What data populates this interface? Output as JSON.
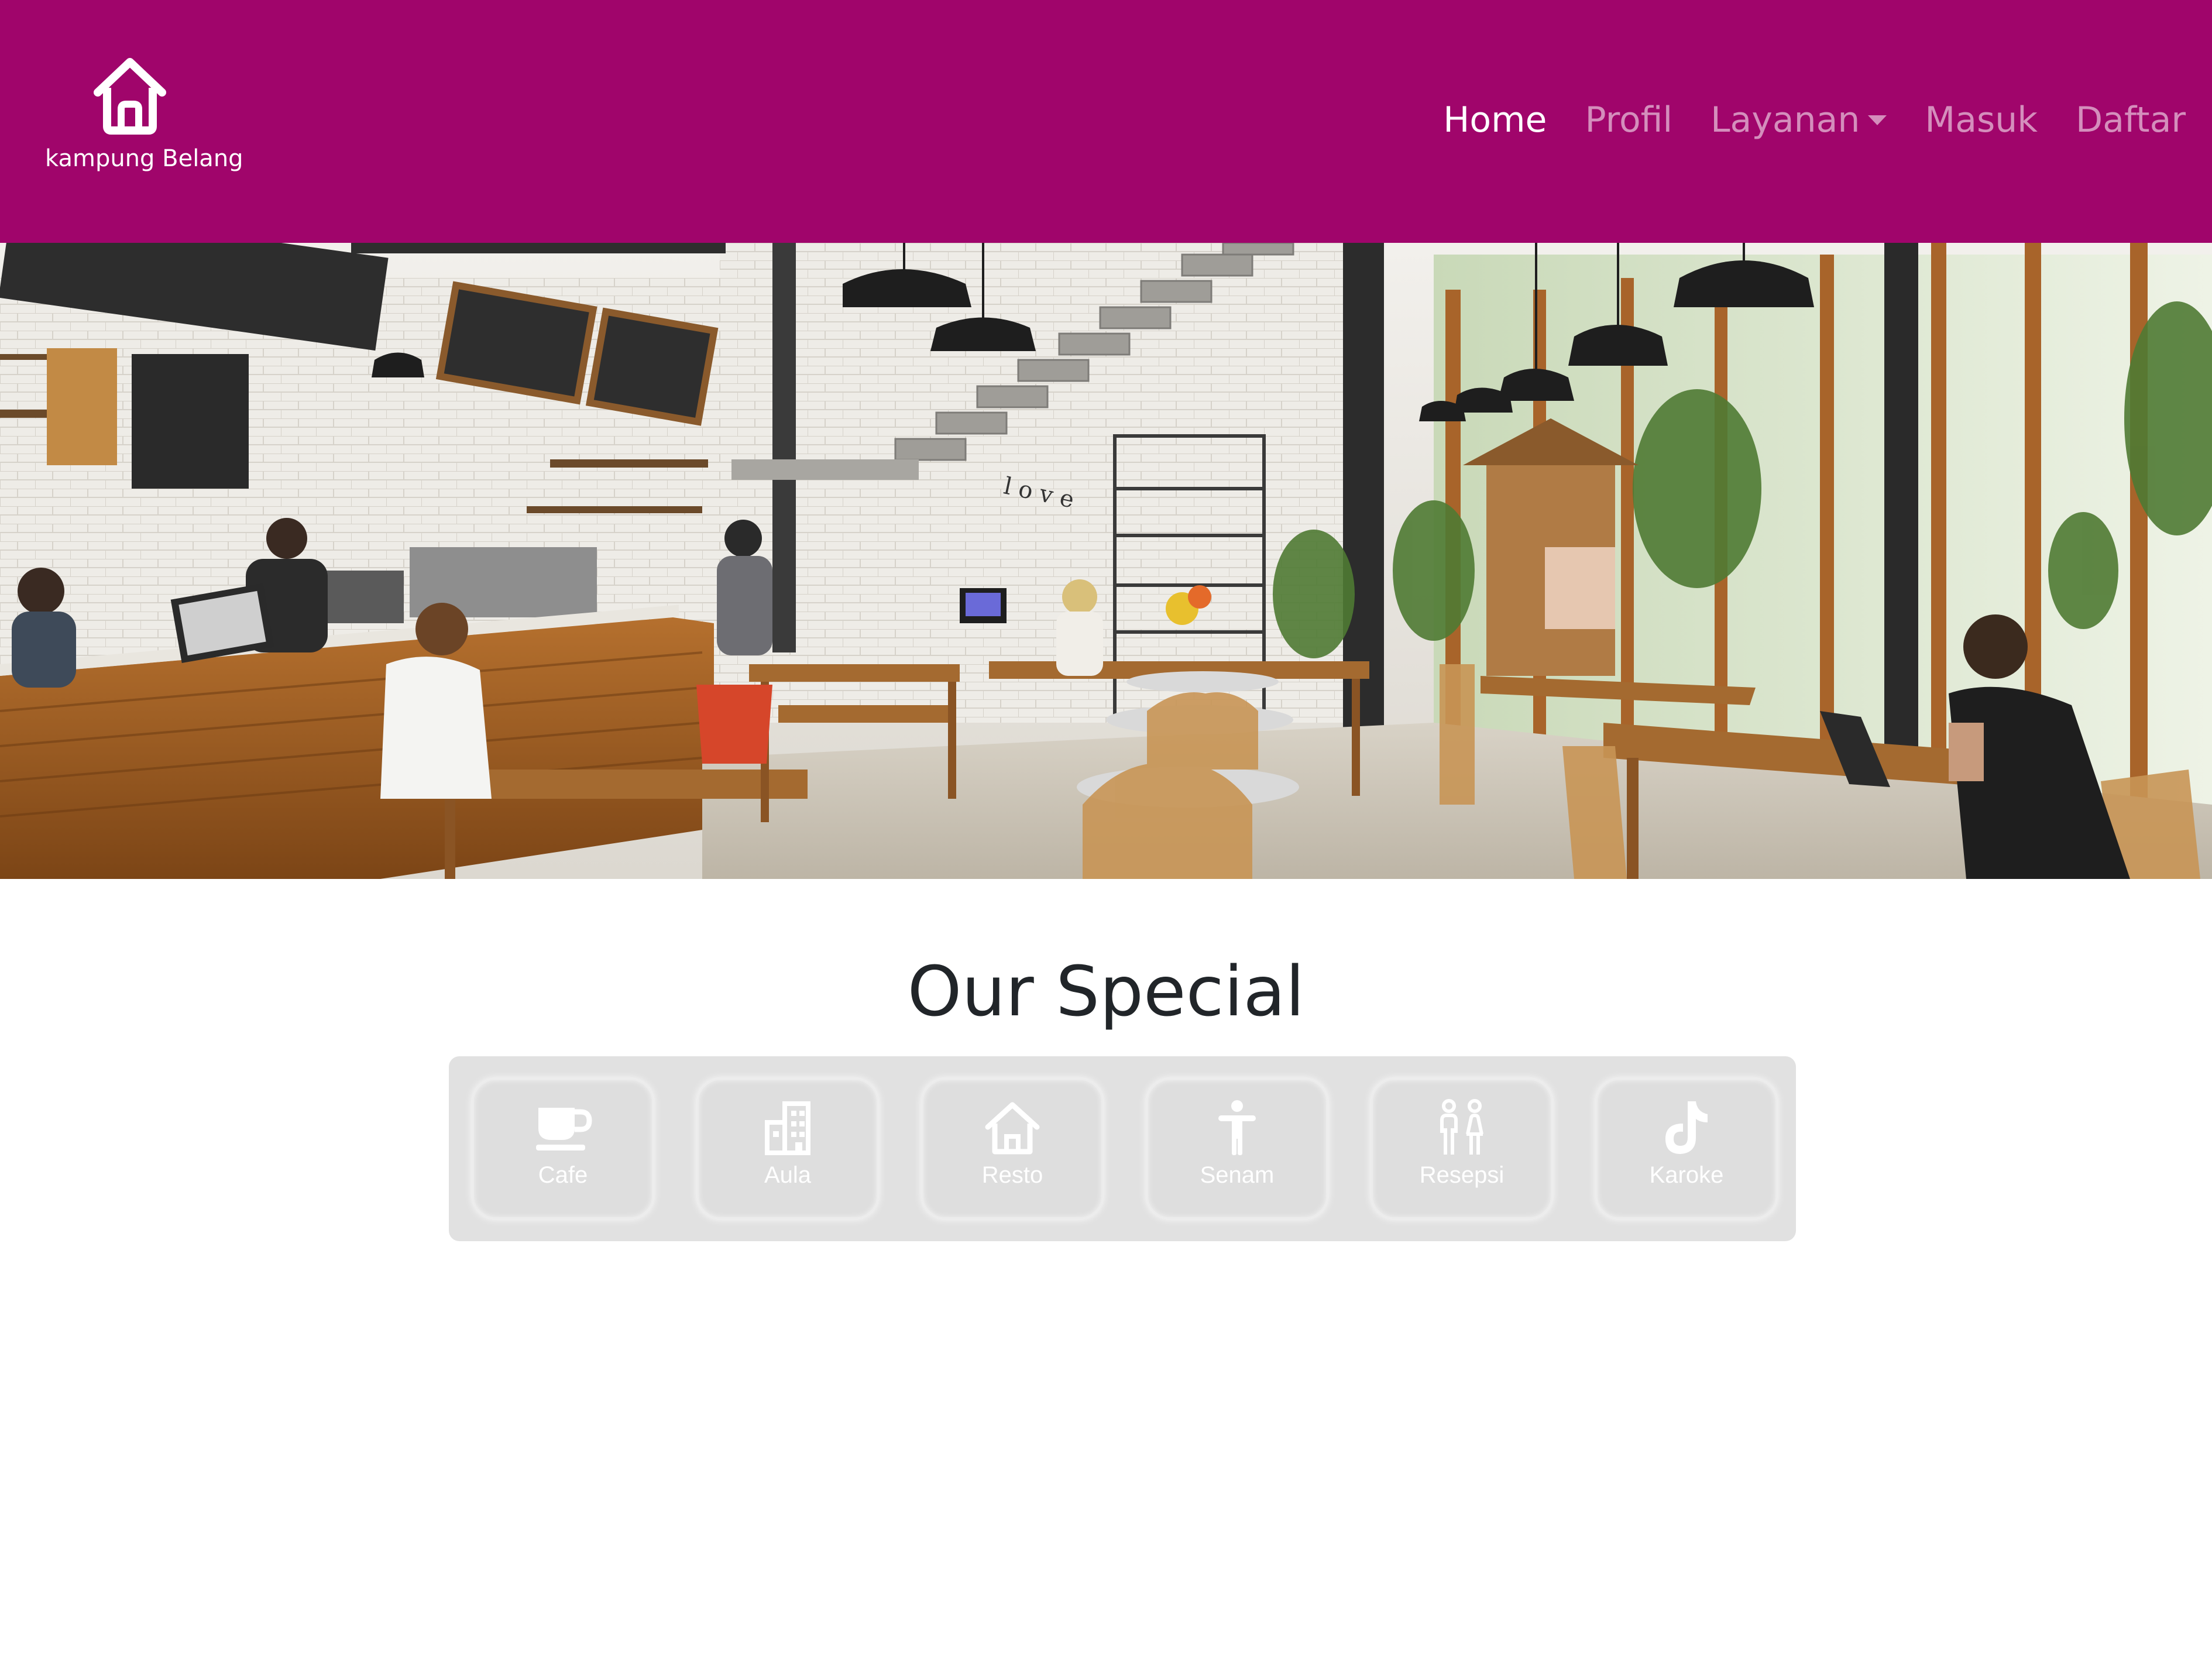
{
  "navbar": {
    "background": "#a0056b",
    "brand": {
      "icon": "house-icon",
      "text": "kampung Belang"
    },
    "links": [
      {
        "label": "Home",
        "active": true
      },
      {
        "label": "Profil",
        "active": false
      },
      {
        "label": "Layanan",
        "active": false,
        "dropdown": true,
        "icon": "caret-down-icon"
      },
      {
        "label": "Masuk",
        "active": false
      },
      {
        "label": "Daftar",
        "active": false
      }
    ]
  },
  "hero": {
    "image": "cafe-interior-photo"
  },
  "special": {
    "title": "Our Special",
    "items": [
      {
        "label": "Cafe",
        "icon": "coffee-cup-icon"
      },
      {
        "label": "Aula",
        "icon": "building-icon"
      },
      {
        "label": "Resto",
        "icon": "house-icon"
      },
      {
        "label": "Senam",
        "icon": "person-standing-icon"
      },
      {
        "label": "Resepsi",
        "icon": "couple-icon"
      },
      {
        "label": "Karoke",
        "icon": "tiktok-note-icon"
      }
    ]
  }
}
